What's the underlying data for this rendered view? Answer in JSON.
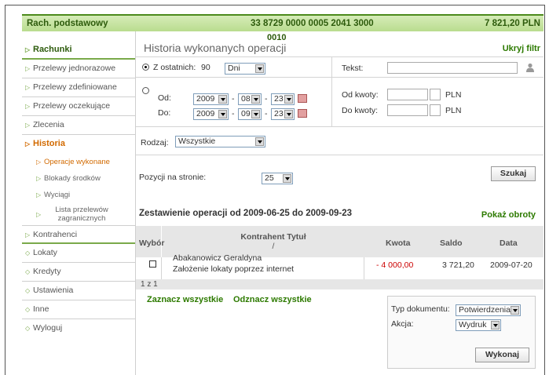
{
  "account": {
    "label": "Rach. podstawowy",
    "number": "33 8729 0000 0005 2041 3000",
    "number_cont": "0010",
    "balance": "7 821,20 PLN"
  },
  "sidebar": {
    "items": [
      {
        "label": "Rachunki"
      },
      {
        "label": "Przelewy jednorazowe"
      },
      {
        "label": "Przelewy zdefiniowane"
      },
      {
        "label": "Przelewy oczekujące"
      },
      {
        "label": "Zlecenia"
      },
      {
        "label": "Historia"
      },
      {
        "label": "Kontrahenci"
      },
      {
        "label": "Lokaty"
      },
      {
        "label": "Kredyty"
      },
      {
        "label": "Ustawienia"
      },
      {
        "label": "Inne"
      },
      {
        "label": "Wyloguj"
      }
    ],
    "subitems": [
      {
        "label": "Operacje wykonane"
      },
      {
        "label": "Blokady środków"
      },
      {
        "label": "Wyciągi"
      },
      {
        "label": "Lista przelewów zagranicznych"
      }
    ]
  },
  "page": {
    "title": "Historia wykonanych operacji",
    "hide_filter": "Ukryj filtr"
  },
  "filter": {
    "last_label": "Z ostatnich:",
    "last_value": "90",
    "last_unit": "Dni",
    "from_label": "Od:",
    "to_label": "Do:",
    "from_date": {
      "year": "2009",
      "month": "08",
      "day": "23"
    },
    "to_date": {
      "year": "2009",
      "month": "09",
      "day": "23"
    },
    "sep": "-",
    "text_label": "Tekst:",
    "amount_from_label": "Od kwoty:",
    "amount_to_label": "Do kwoty:",
    "currency": "PLN",
    "type_label": "Rodzaj:",
    "type_value": "Wszystkie",
    "per_page_label": "Pozycji na stronie:",
    "per_page_value": "25",
    "search_button": "Szukaj"
  },
  "summary": {
    "title": "Zestawienie operacji od 2009-06-25 do 2009-09-23",
    "show_turnover": "Pokaż obroty"
  },
  "table": {
    "headers": {
      "select": "Wybór",
      "party": "Kontrahent Tytuł",
      "party_sep": "/",
      "amount": "Kwota",
      "balance": "Saldo",
      "date": "Data"
    },
    "rows": [
      {
        "party": "Abakanowicz Geraldyna",
        "title": "Założenie lokaty poprzez internet",
        "amount": "- 4 000,00",
        "balance": "3 721,20",
        "date": "2009-07-20"
      }
    ],
    "pager": "1 z 1"
  },
  "links": {
    "select_all": "Zaznacz wszystkie",
    "deselect_all": "Odznacz wszystkie"
  },
  "action": {
    "doc_type_label": "Typ dokumentu:",
    "doc_type_value": "Potwierdzenia",
    "action_label": "Akcja:",
    "action_value": "Wydruk",
    "execute_button": "Wykonaj"
  },
  "colors": {
    "accent_green": "#2d7a00",
    "active_orange": "#d26a00",
    "negative": "#cc0000"
  },
  "icons": {
    "person": "person-icon",
    "calendar": "calendar-icon",
    "arrow": "arrow-icon",
    "dropdown": "chevron-down-icon"
  }
}
